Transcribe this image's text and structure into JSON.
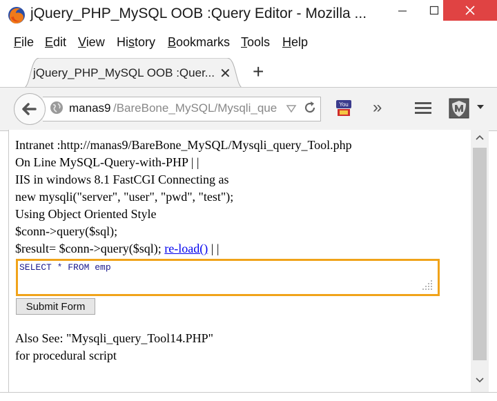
{
  "window": {
    "title": "jQuery_PHP_MySQL OOB :Query Editor - Mozilla ...",
    "accent_close": "#e04343"
  },
  "menu": {
    "file": {
      "pre": "",
      "u": "F",
      "post": "ile"
    },
    "edit": {
      "pre": "",
      "u": "E",
      "post": "dit"
    },
    "view": {
      "pre": "",
      "u": "V",
      "post": "iew"
    },
    "history": {
      "pre": "Hi",
      "u": "s",
      "post": "tory"
    },
    "bookmarks": {
      "pre": "",
      "u": "B",
      "post": "ookmarks"
    },
    "tools": {
      "pre": "",
      "u": "T",
      "post": "ools"
    },
    "help": {
      "pre": "",
      "u": "H",
      "post": "elp"
    }
  },
  "tab": {
    "title": "jQuery_PHP_MySQL OOB :Quer...",
    "close": "✕",
    "new_tab": "+"
  },
  "urlbar": {
    "host": "manas9",
    "path": "/BareBone_MySQL/Mysqli_que"
  },
  "toolbar": {
    "overflow": "»"
  },
  "content": {
    "lines": [
      "Intranet :http://manas9/BareBone_MySQL/Mysqli_query_Tool.php",
      "On Line MySQL-Query-with-PHP | |",
      "IIS in windows 8.1 FastCGI Connecting as",
      "new mysqli(\"server\", \"user\", \"pwd\", \"test\");",
      "Using Object Oriented Style",
      "$conn->query($sql);",
      "$result= $conn->query($sql);"
    ],
    "reload_link": "re-load()",
    "after_link": " | |",
    "query": "SELECT * FROM emp",
    "submit_label": "Submit Form",
    "also_see": "Also See: \"Mysqli_query_Tool14.PHP\"",
    "procedural": "for procedural script"
  },
  "colors": {
    "query_border": "#f0a31a",
    "link": "#0000ee"
  }
}
